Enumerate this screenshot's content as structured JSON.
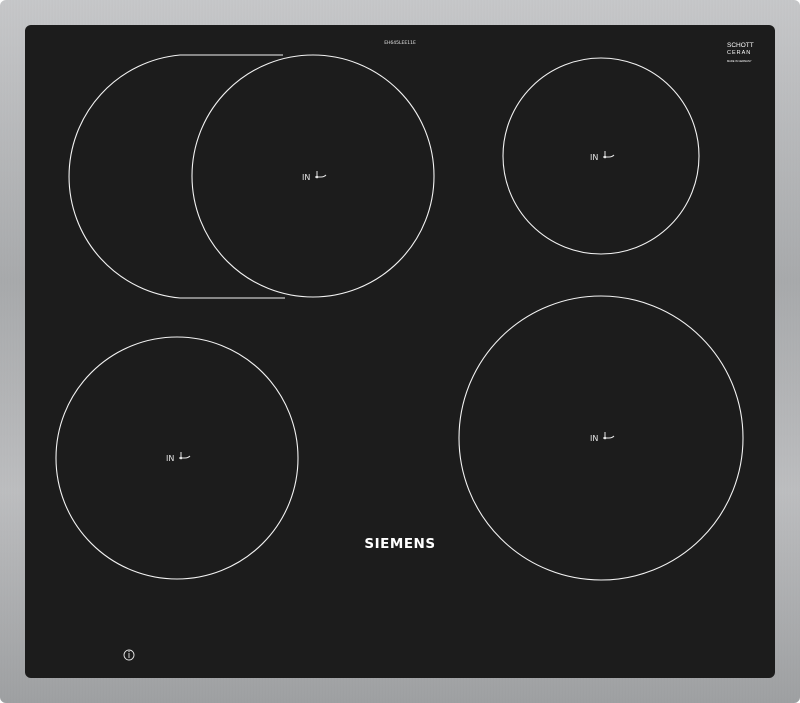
{
  "product": {
    "model_code": "EH645LEE11E",
    "brand": "SIEMENS",
    "glass_logo": {
      "line1": "SCHOTT",
      "line2": "CERAN",
      "subtext": "MADE IN GERMANY"
    }
  },
  "zones": [
    {
      "id": "front-left-extended",
      "label": "IN",
      "type": "induction-extended"
    },
    {
      "id": "rear-right",
      "label": "IN",
      "type": "induction"
    },
    {
      "id": "front-left",
      "label": "IN",
      "type": "induction"
    },
    {
      "id": "front-right",
      "label": "IN",
      "type": "induction"
    }
  ],
  "controls": {
    "info_icon": "info-icon"
  },
  "colors": {
    "glass": "#1c1c1c",
    "frame": "#b5b6b8",
    "markings": "#f2f2f2"
  }
}
